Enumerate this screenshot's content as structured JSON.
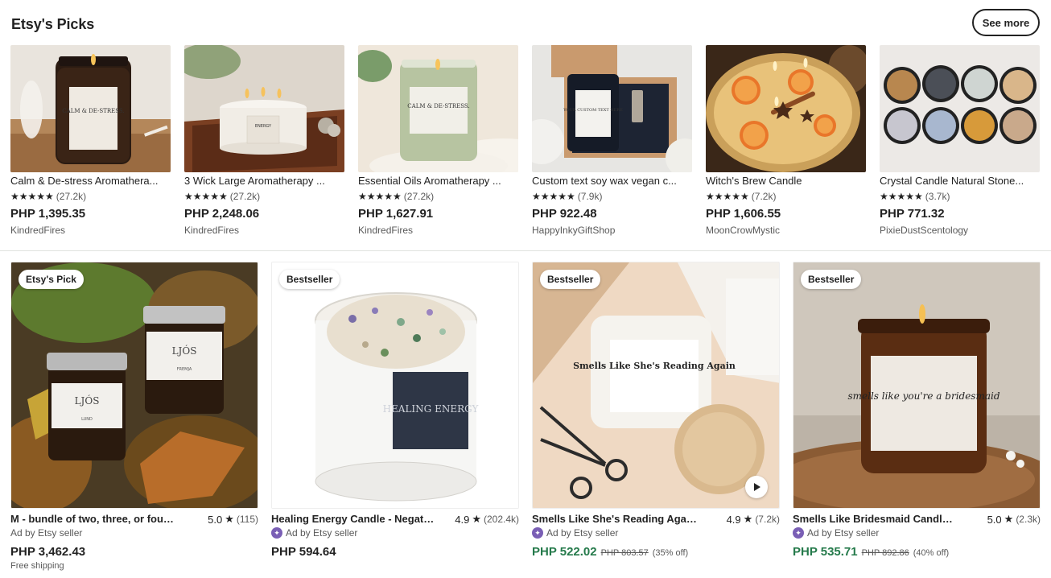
{
  "section": {
    "title": "Etsy's Picks",
    "see_more_label": "See more"
  },
  "picks": [
    {
      "title": "Calm & De-stress Aromathera...",
      "stars": "★★★★★",
      "reviews": "(27.2k)",
      "price": "PHP 1,395.35",
      "shop": "KindredFires",
      "label_text": "CALM & DE-STRESS."
    },
    {
      "title": "3 Wick Large Aromatherapy ...",
      "stars": "★★★★★",
      "reviews": "(27.2k)",
      "price": "PHP 2,248.06",
      "shop": "KindredFires",
      "label_text": "ENERGY"
    },
    {
      "title": "Essential Oils Aromatherapy ...",
      "stars": "★★★★★",
      "reviews": "(27.2k)",
      "price": "PHP 1,627.91",
      "shop": "KindredFires",
      "label_text": "CALM & DE-STRESS."
    },
    {
      "title": "Custom text soy wax vegan c...",
      "stars": "★★★★★",
      "reviews": "(7.9k)",
      "price": "PHP 922.48",
      "shop": "HappyInkyGiftShop",
      "label_text": "YOUR CUSTOM TEXT HERE"
    },
    {
      "title": "Witch's Brew Candle",
      "stars": "★★★★★",
      "reviews": "(7.2k)",
      "price": "PHP 1,606.55",
      "shop": "MoonCrowMystic"
    },
    {
      "title": "Crystal Candle Natural Stone...",
      "stars": "★★★★★",
      "reviews": "(3.7k)",
      "price": "PHP 771.32",
      "shop": "PixieDustScentology"
    }
  ],
  "ads": [
    {
      "badge": "Etsy's Pick",
      "title": "M - bundle of two, three, or four ...",
      "rating": "5.0",
      "star": "★",
      "reviews": "(115)",
      "ad_by": "Ad by Etsy seller",
      "price": "PHP 3,462.43",
      "shipping": "Free shipping",
      "label_text": "LJÓS",
      "label_sub_1": "LUND",
      "label_sub_2": "FREMJA"
    },
    {
      "badge": "Bestseller",
      "title": "Healing Energy Candle - Negativ...",
      "rating": "4.9",
      "star": "★",
      "reviews": "(202.4k)",
      "ad_by": "Ad by Etsy seller",
      "price": "PHP 594.64",
      "label_text": "HEALING ENERGY"
    },
    {
      "badge": "Bestseller",
      "title": "Smells Like She's Reading Again,...",
      "rating": "4.9",
      "star": "★",
      "reviews": "(7.2k)",
      "ad_by": "Ad by Etsy seller",
      "price": "PHP 522.02",
      "original_price": "PHP 803.57",
      "discount": "(35% off)",
      "label_text": "Smells Like She's Reading Again"
    },
    {
      "badge": "Bestseller",
      "title": "Smells Like Bridesmaid Candle, ...",
      "rating": "5.0",
      "star": "★",
      "reviews": "(2.3k)",
      "ad_by": "Ad by Etsy seller",
      "price": "PHP 535.71",
      "original_price": "PHP 892.86",
      "discount": "(40% off)",
      "label_text": "smells like you're a bridesmaid"
    }
  ],
  "colors": {
    "sale_price": "#257a4b",
    "ad_badge": "#7a5fb5",
    "divider": "#e1e3df"
  },
  "icons": {
    "star": "star-icon",
    "ad_seller": "etsy-seller-badge-icon",
    "play": "play-icon"
  }
}
